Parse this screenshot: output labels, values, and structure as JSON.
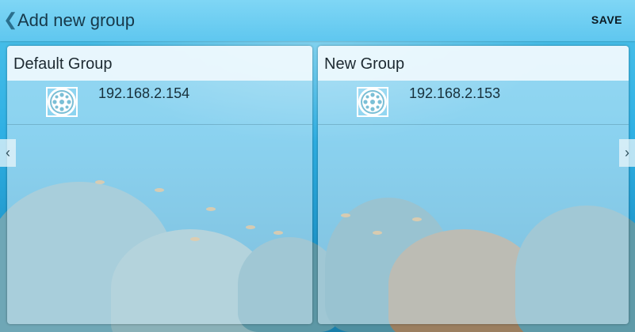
{
  "header": {
    "back_icon": "chevron-left-icon",
    "title": "Add new group",
    "save_label": "SAVE"
  },
  "groups": [
    {
      "title": "Default Group",
      "devices": [
        {
          "icon": "device-icon",
          "ip": "192.168.2.154"
        }
      ]
    },
    {
      "title": "New Group",
      "devices": [
        {
          "icon": "device-icon",
          "ip": "192.168.2.153"
        }
      ]
    }
  ],
  "pager": {
    "prev_icon": "chevron-left-icon",
    "next_icon": "chevron-right-icon"
  },
  "colors": {
    "topbar": "#5fc7ef",
    "panel_header": "#ecf8fd",
    "text": "#1d2a31"
  }
}
